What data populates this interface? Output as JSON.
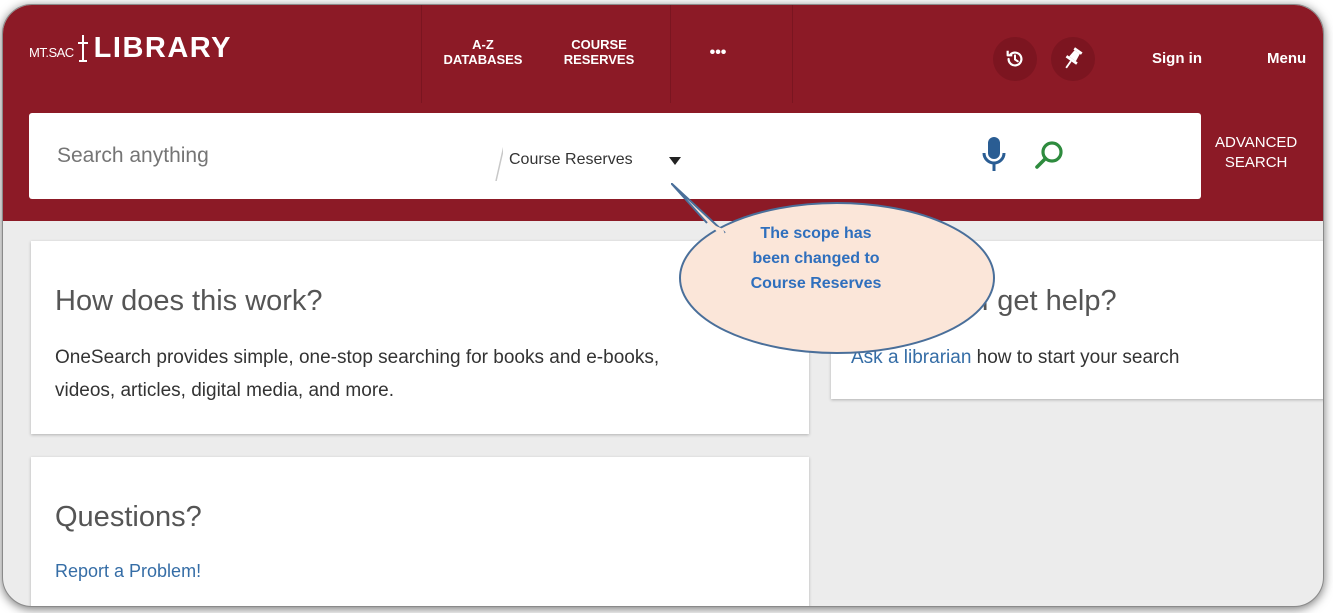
{
  "header": {
    "logo_small": "MT.SAC",
    "logo_main": "LIBRARY",
    "nav": [
      {
        "line1": "A-Z",
        "line2": "DATABASES"
      },
      {
        "line1": "COURSE",
        "line2": "RESERVES"
      }
    ],
    "more_label": "•••",
    "sign_in": "Sign in",
    "menu": "Menu"
  },
  "search": {
    "placeholder": "Search anything",
    "value": "",
    "scope_selected": "Course Reserves",
    "advanced_line1": "ADVANCED",
    "advanced_line2": "SEARCH"
  },
  "callout": {
    "line1": "The scope has",
    "line2": "been changed to",
    "line3": "Course Reserves"
  },
  "cards": {
    "how": {
      "title": "How does this work?",
      "body_line1": "OneSearch provides simple, one-stop searching for books and e-books,",
      "body_line2": "videos, articles, digital media, and more."
    },
    "help": {
      "title_visible": "n I get help?",
      "link": "Ask a librarian",
      "rest": " how to start your search"
    },
    "questions": {
      "title": "Questions?",
      "link": "Report a Problem!"
    }
  },
  "colors": {
    "brand": "#8c1a26",
    "link": "#356da6",
    "mic": "#2a5d93",
    "search_icon": "#2e8b3e",
    "callout_fill": "#fbe6d9",
    "callout_border": "#4a6f9a",
    "callout_text": "#2f6fbd"
  },
  "icons": [
    "history-icon",
    "pin-icon",
    "microphone-icon",
    "search-icon",
    "dropdown-arrow-icon"
  ]
}
